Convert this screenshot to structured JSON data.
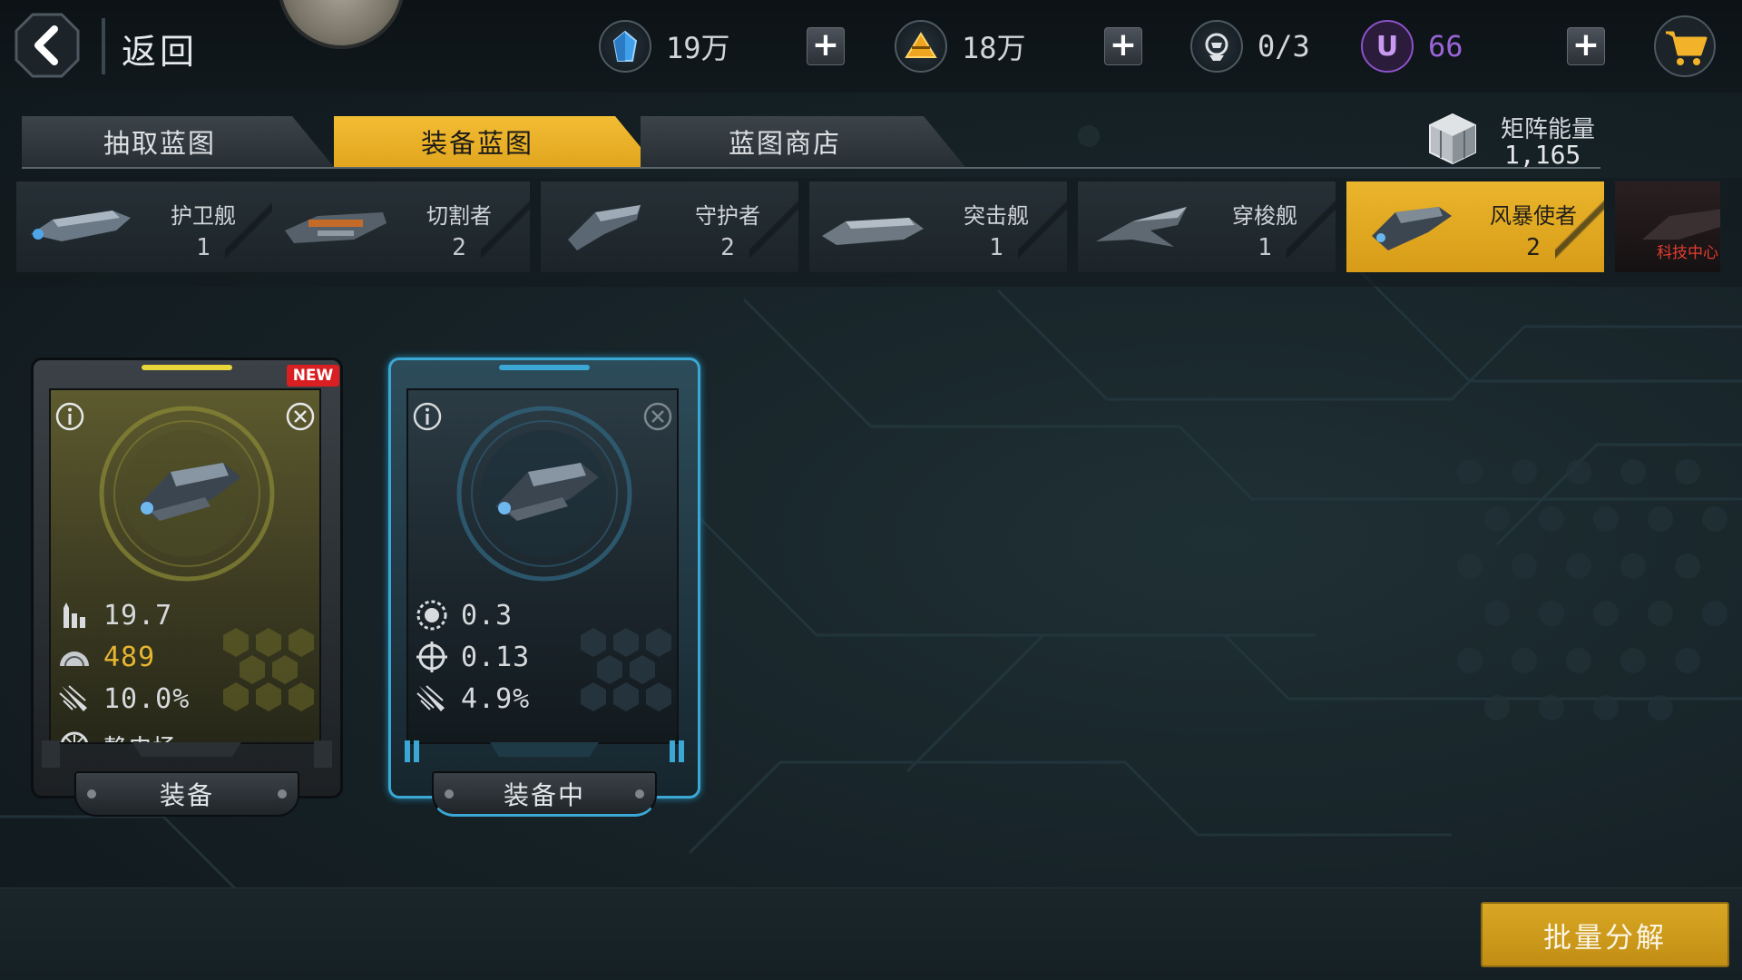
{
  "topbar": {
    "back_label": "返回",
    "crystal": {
      "icon": "blue-crystal-icon",
      "value": "19万"
    },
    "gold": {
      "icon": "gold-ingot-icon",
      "value": "18万"
    },
    "crew": {
      "icon": "pilot-helmet-icon",
      "value": "0/3"
    },
    "premium": {
      "icon": "u-coin-icon",
      "value": "66",
      "color": "#8e52c9"
    }
  },
  "tabs": [
    {
      "label": "抽取蓝图",
      "active": false
    },
    {
      "label": "装备蓝图",
      "active": true
    },
    {
      "label": "蓝图商店",
      "active": false
    }
  ],
  "matrix_energy": {
    "label": "矩阵能量",
    "value": "1,165"
  },
  "categories": [
    {
      "name": "护卫舰",
      "count": "1",
      "selected": false
    },
    {
      "name": "切割者",
      "count": "2",
      "selected": false
    },
    {
      "name": "守护者",
      "count": "2",
      "selected": false
    },
    {
      "name": "突击舰",
      "count": "1",
      "selected": false
    },
    {
      "name": "穿梭舰",
      "count": "1",
      "selected": false
    },
    {
      "name": "风暴使者",
      "count": "2",
      "selected": true
    },
    {
      "name": "科技中心",
      "count": "",
      "selected": false
    }
  ],
  "cards": [
    {
      "badge": "NEW",
      "stats": [
        {
          "icon": "ammo-icon",
          "value": "19.7"
        },
        {
          "icon": "shield-dome-icon",
          "value": "489",
          "highlight": true
        },
        {
          "icon": "missile-icon",
          "value": "10.0%"
        },
        {
          "icon": "static-field-icon",
          "value": "静电场"
        }
      ],
      "button": "装备"
    },
    {
      "stats": [
        {
          "icon": "gear-burst-icon",
          "value": "0.3"
        },
        {
          "icon": "crosshair-icon",
          "value": "0.13"
        },
        {
          "icon": "missile-icon",
          "value": "4.9%"
        }
      ],
      "button": "装备中"
    }
  ],
  "bulk_button": "批量分解",
  "colors": {
    "accent": "#e9b22a",
    "equipped": "#3aa7d4",
    "badge": "#d91f21"
  }
}
